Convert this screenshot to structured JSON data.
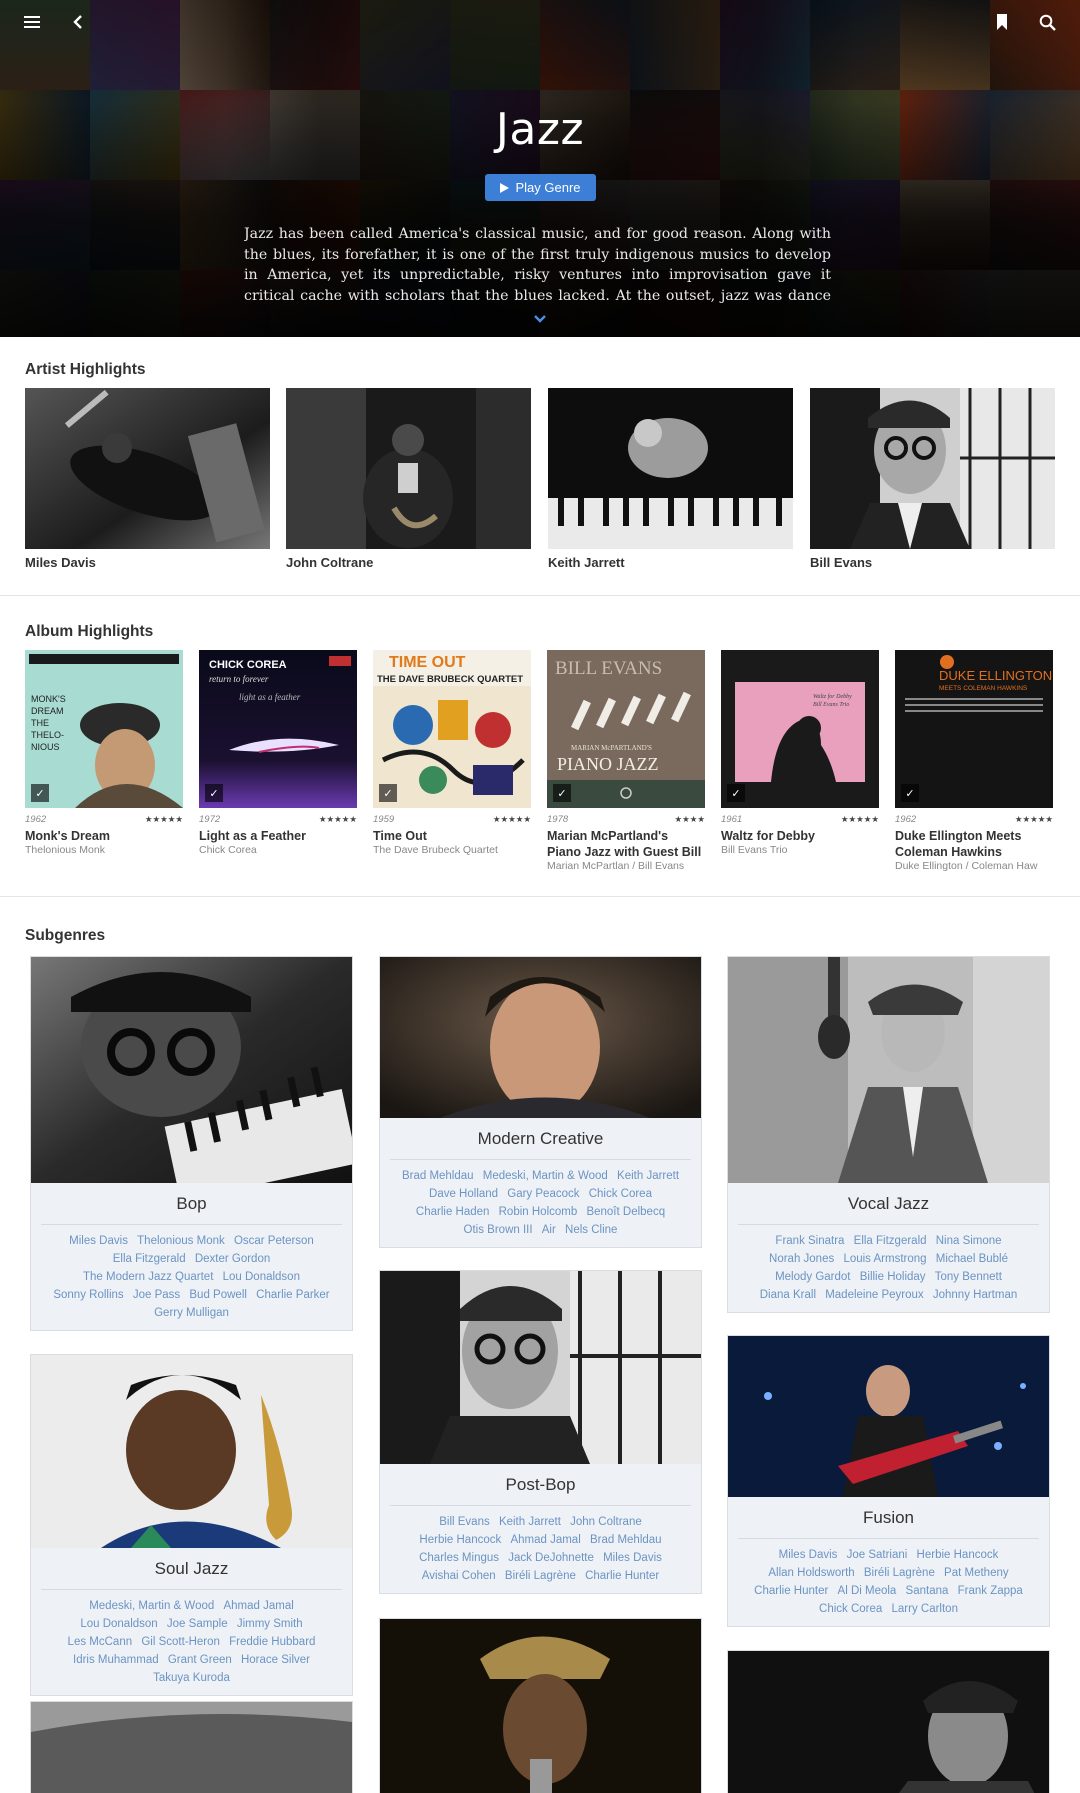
{
  "colors": {
    "accent": "#3d7fd6",
    "link": "#6b94c4",
    "card_bg": "#eef1f5"
  },
  "header": {
    "menu_icon": "hamburger-menu-icon",
    "back_icon": "back-arrow-icon",
    "bookmark_icon": "bookmark-icon",
    "search_icon": "search-icon"
  },
  "hero": {
    "title": "Jazz",
    "play_button": "Play Genre",
    "description": "Jazz has been called America's classical music, and for good reason. Along with the blues, its forefather, it is one of the first truly indigenous musics to develop in America, yet its unpredictable, risky ventures into improvisation gave it critical cache with scholars that the blues lacked. At the outset, jazz was dance music,"
  },
  "artist_highlights": {
    "title": "Artist Highlights",
    "artists": [
      {
        "name": "Miles Davis"
      },
      {
        "name": "John Coltrane"
      },
      {
        "name": "Keith Jarrett"
      },
      {
        "name": "Bill Evans"
      }
    ]
  },
  "album_highlights": {
    "title": "Album Highlights",
    "albums": [
      {
        "year": "1962",
        "stars": "★★★★★",
        "title": "Monk's Dream",
        "artist": "Thelonious Monk"
      },
      {
        "year": "1972",
        "stars": "★★★★★",
        "title": "Light as a Feather",
        "artist": "Chick Corea"
      },
      {
        "year": "1959",
        "stars": "★★★★★",
        "title": "Time Out",
        "artist": "The Dave Brubeck Quartet"
      },
      {
        "year": "1978",
        "stars": "★★★★",
        "title": "Marian McPartland's Piano Jazz with Guest Bill",
        "artist": "Marian McPartlan / Bill Evans"
      },
      {
        "year": "1961",
        "stars": "★★★★★",
        "title": "Waltz for Debby",
        "artist": "Bill Evans Trio"
      },
      {
        "year": "1962",
        "stars": "★★★★★",
        "title": "Duke Ellington Meets Coleman Hawkins",
        "artist": "Duke Ellington / Coleman Haw"
      }
    ]
  },
  "subgenres": {
    "title": "Subgenres",
    "items": [
      {
        "name": "Bop",
        "artists": [
          "Miles Davis",
          "Thelonious Monk",
          "Oscar Peterson",
          "Ella Fitzgerald",
          "Dexter Gordon",
          "The Modern Jazz Quartet",
          "Lou Donaldson",
          "Sonny Rollins",
          "Joe Pass",
          "Bud Powell",
          "Charlie Parker",
          "Gerry Mulligan"
        ]
      },
      {
        "name": "Modern Creative",
        "artists": [
          "Brad Mehldau",
          "Medeski, Martin & Wood",
          "Keith Jarrett",
          "Dave Holland",
          "Gary Peacock",
          "Chick Corea",
          "Charlie Haden",
          "Robin Holcomb",
          "Benoît Delbecq",
          "Otis Brown III",
          "Air",
          "Nels Cline"
        ]
      },
      {
        "name": "Vocal Jazz",
        "artists": [
          "Frank Sinatra",
          "Ella Fitzgerald",
          "Nina Simone",
          "Norah Jones",
          "Louis Armstrong",
          "Michael Bublé",
          "Melody Gardot",
          "Billie Holiday",
          "Tony Bennett",
          "Diana Krall",
          "Madeleine Peyroux",
          "Johnny Hartman"
        ]
      },
      {
        "name": "Soul Jazz",
        "artists": [
          "Medeski, Martin & Wood",
          "Ahmad Jamal",
          "Lou Donaldson",
          "Joe Sample",
          "Jimmy Smith",
          "Les McCann",
          "Gil Scott-Heron",
          "Freddie Hubbard",
          "Idris Muhammad",
          "Grant Green",
          "Horace Silver",
          "Takuya Kuroda"
        ]
      },
      {
        "name": "Post-Bop",
        "artists": [
          "Bill Evans",
          "Keith Jarrett",
          "John Coltrane",
          "Herbie Hancock",
          "Ahmad Jamal",
          "Brad Mehldau",
          "Charles Mingus",
          "Jack DeJohnette",
          "Miles Davis",
          "Avishai Cohen",
          "Biréli Lagrène",
          "Charlie Hunter"
        ]
      },
      {
        "name": "Fusion",
        "artists": [
          "Miles Davis",
          "Joe Satriani",
          "Herbie Hancock",
          "Allan Holdsworth",
          "Biréli Lagrène",
          "Pat Metheny",
          "Charlie Hunter",
          "Al Di Meola",
          "Santana",
          "Frank Zappa",
          "Chick Corea",
          "Larry Carlton"
        ]
      }
    ]
  }
}
